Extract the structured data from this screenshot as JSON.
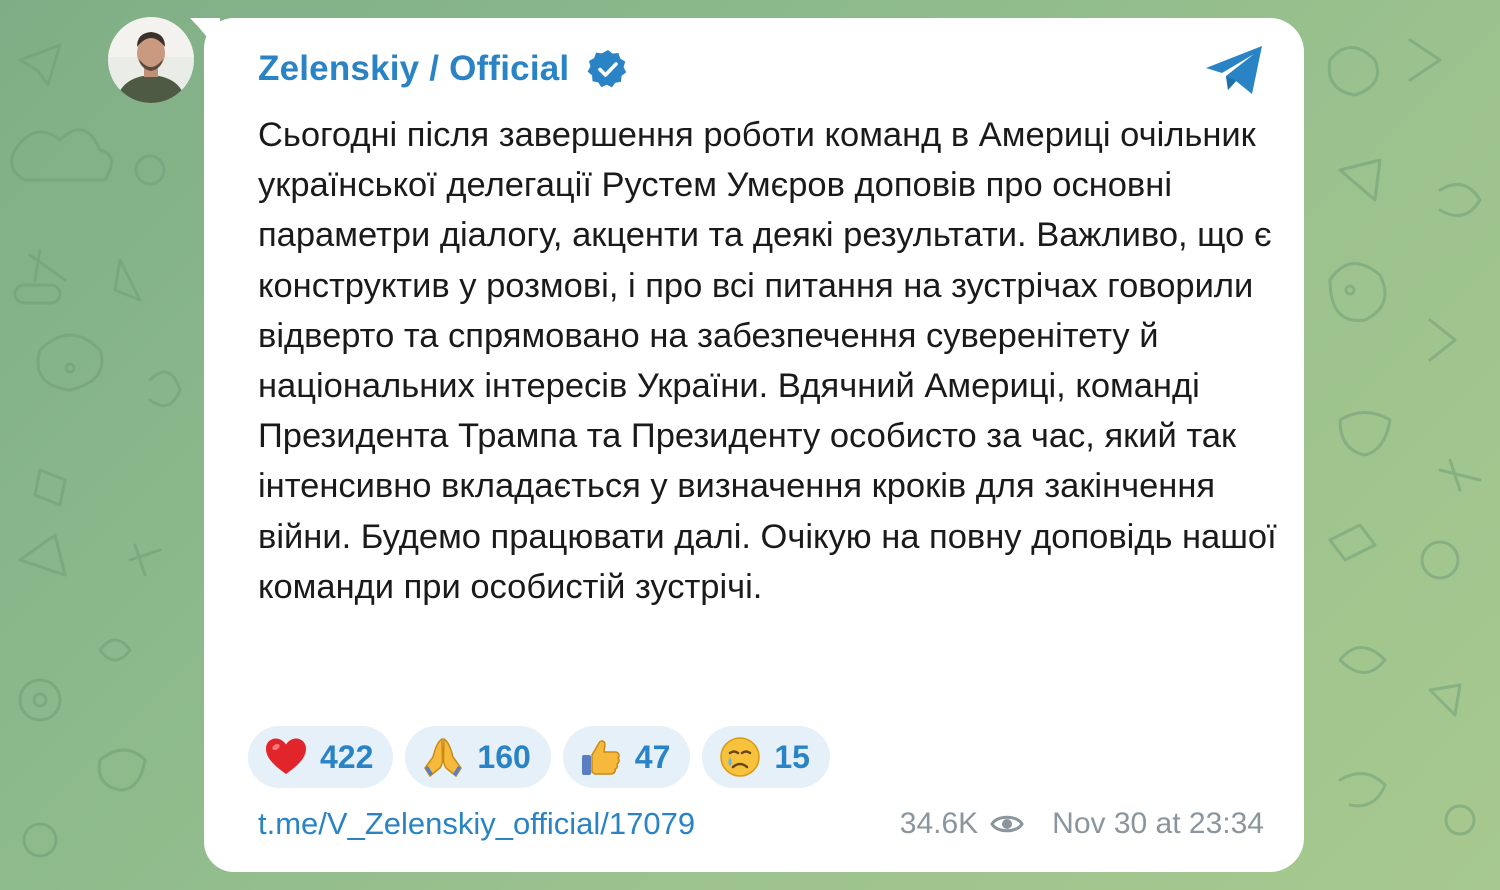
{
  "channel": {
    "name": "Zelenskiy / Official",
    "verified_icon": "verified-badge-icon",
    "accent_color": "#2a83c4"
  },
  "message": {
    "text": "Сьогодні після завершення роботи команд в Америці очільник української делегації Рустем Умєров доповів про основні параметри діалогу, акценти та деякі результати. Важливо, що є конструктив у розмові, і про всі питання на зустрічах говорили відверто та спрямовано на забезпечення суверенітету й національних інтересів України. Вдячний Америці, команді Президента Трампа та Президенту особисто за час, який так інтенсивно вкладається у визначення кроків для закінчення війни. Будемо працювати далі. Очікую на повну доповідь нашої команди при особистій зустрічі."
  },
  "reactions": [
    {
      "emoji": "heart-icon",
      "count": "422"
    },
    {
      "emoji": "praying-hands-icon",
      "count": "160"
    },
    {
      "emoji": "thumbs-up-icon",
      "count": "47"
    },
    {
      "emoji": "crying-face-icon",
      "count": "15"
    }
  ],
  "footer": {
    "link": "t.me/V_Zelenskiy_official/17079",
    "views": "34.6K",
    "timestamp": "Nov 30 at 23:34"
  },
  "icons": {
    "share": "telegram-send-icon",
    "views": "eye-icon"
  }
}
